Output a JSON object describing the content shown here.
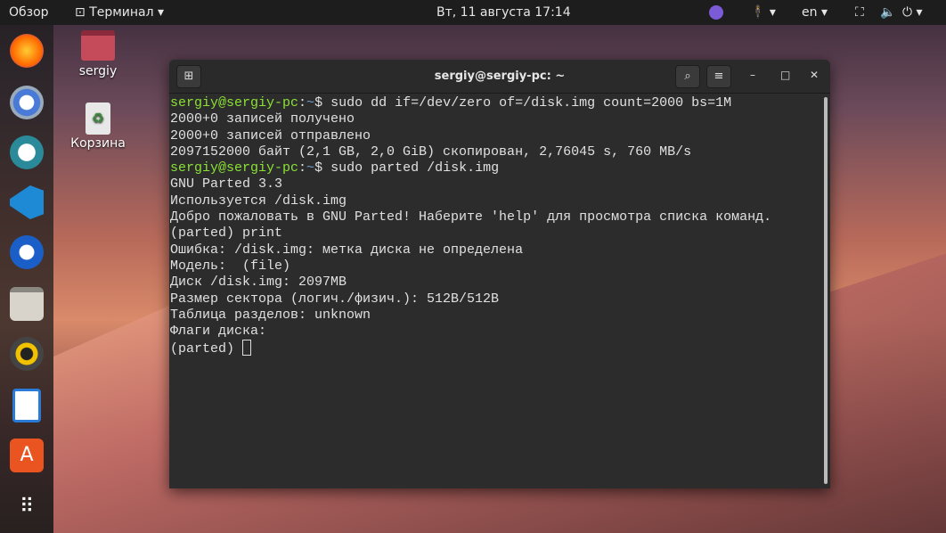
{
  "topbar": {
    "overview": "Обзор",
    "app_menu": "Терминал",
    "clock": "Вт, 11 августа  17:14",
    "lang": "en"
  },
  "desktop": {
    "home_label": "sergiy",
    "trash_label": "Корзина"
  },
  "dock": {
    "items": [
      "firefox",
      "chromium",
      "remmina",
      "vscode",
      "thunderbird",
      "files",
      "rhythmbox",
      "libreoffice-writer",
      "software-center",
      "show-apps"
    ]
  },
  "terminal": {
    "title": "sergiy@sergiy-pc: ~",
    "user_host": "sergiy@sergiy-pc",
    "path": "~",
    "lines": [
      {
        "prompt": true,
        "cmd": "sudo dd if=/dev/zero of=/disk.img count=2000 bs=1M"
      },
      {
        "text": "2000+0 записей получено"
      },
      {
        "text": "2000+0 записей отправлено"
      },
      {
        "text": "2097152000 байт (2,1 GB, 2,0 GiB) скопирован, 2,76045 s, 760 MB/s"
      },
      {
        "prompt": true,
        "cmd": "sudo parted /disk.img"
      },
      {
        "text": "GNU Parted 3.3"
      },
      {
        "text": "Используется /disk.img"
      },
      {
        "text": "Добро пожаловать в GNU Parted! Наберите 'help' для просмотра списка команд."
      },
      {
        "text": "(parted) print"
      },
      {
        "text": "Ошибка: /disk.img: метка диска не определена"
      },
      {
        "text": "Модель:  (file)"
      },
      {
        "text": "Диск /disk.img: 2097MB"
      },
      {
        "text": "Размер сектора (логич./физич.): 512B/512B"
      },
      {
        "text": "Таблица разделов: unknown"
      },
      {
        "text": "Флаги диска:"
      }
    ],
    "current_prompt": "(parted) "
  }
}
